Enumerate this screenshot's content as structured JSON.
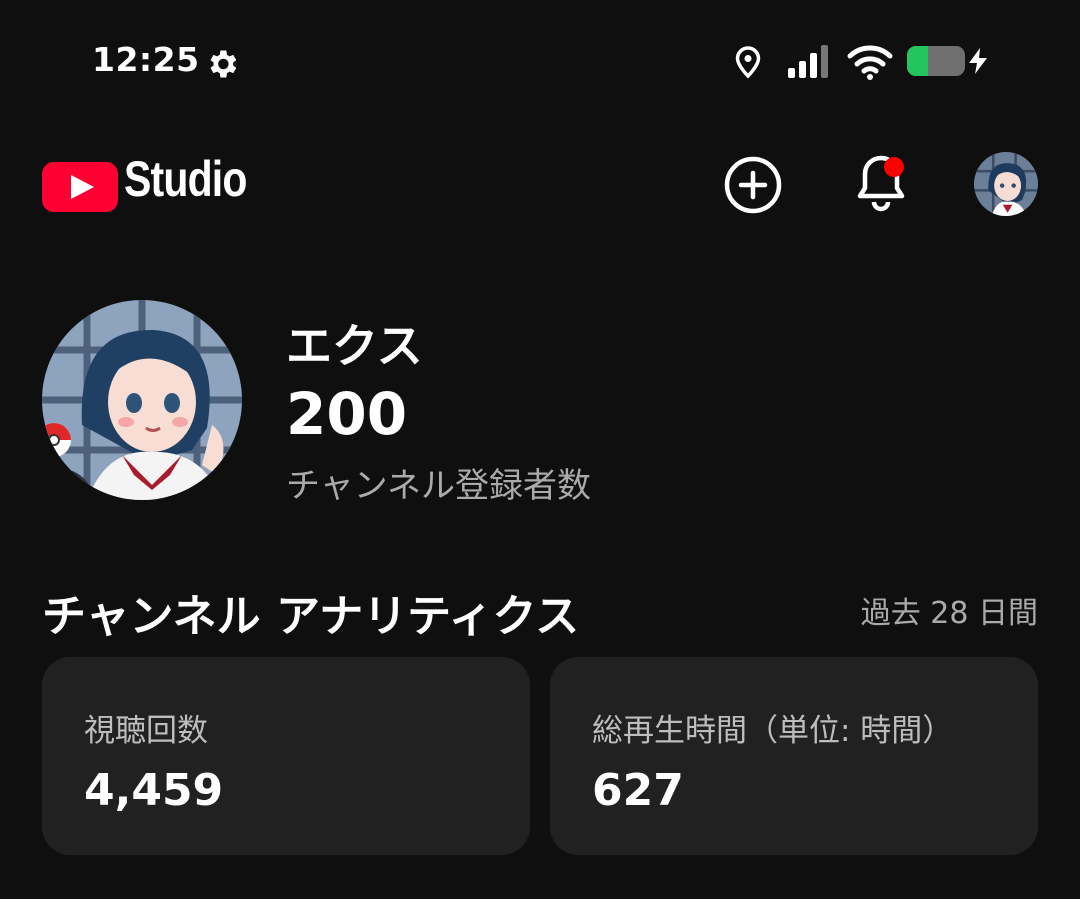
{
  "status_bar": {
    "time": "12:25",
    "icons": [
      "gear-icon",
      "location-icon",
      "signal-icon",
      "wifi-icon",
      "battery-charging-icon"
    ]
  },
  "header": {
    "app_name": "Studio",
    "logo": "youtube-play-logo",
    "brand_color": "#ff0033",
    "notification_dot_color": "#ff0000",
    "actions": [
      "create-plus-icon",
      "notification-bell-icon",
      "account-avatar"
    ]
  },
  "channel": {
    "name": "エクス",
    "subscriber_count": "200",
    "subscriber_label": "チャンネル登録者数"
  },
  "analytics": {
    "title": "チャンネル アナリティクス",
    "period": "過去 28 日間",
    "cards": [
      {
        "label": "視聴回数",
        "value": "4,459"
      },
      {
        "label": "総再生時間（単位: 時間）",
        "value": "627"
      }
    ]
  }
}
